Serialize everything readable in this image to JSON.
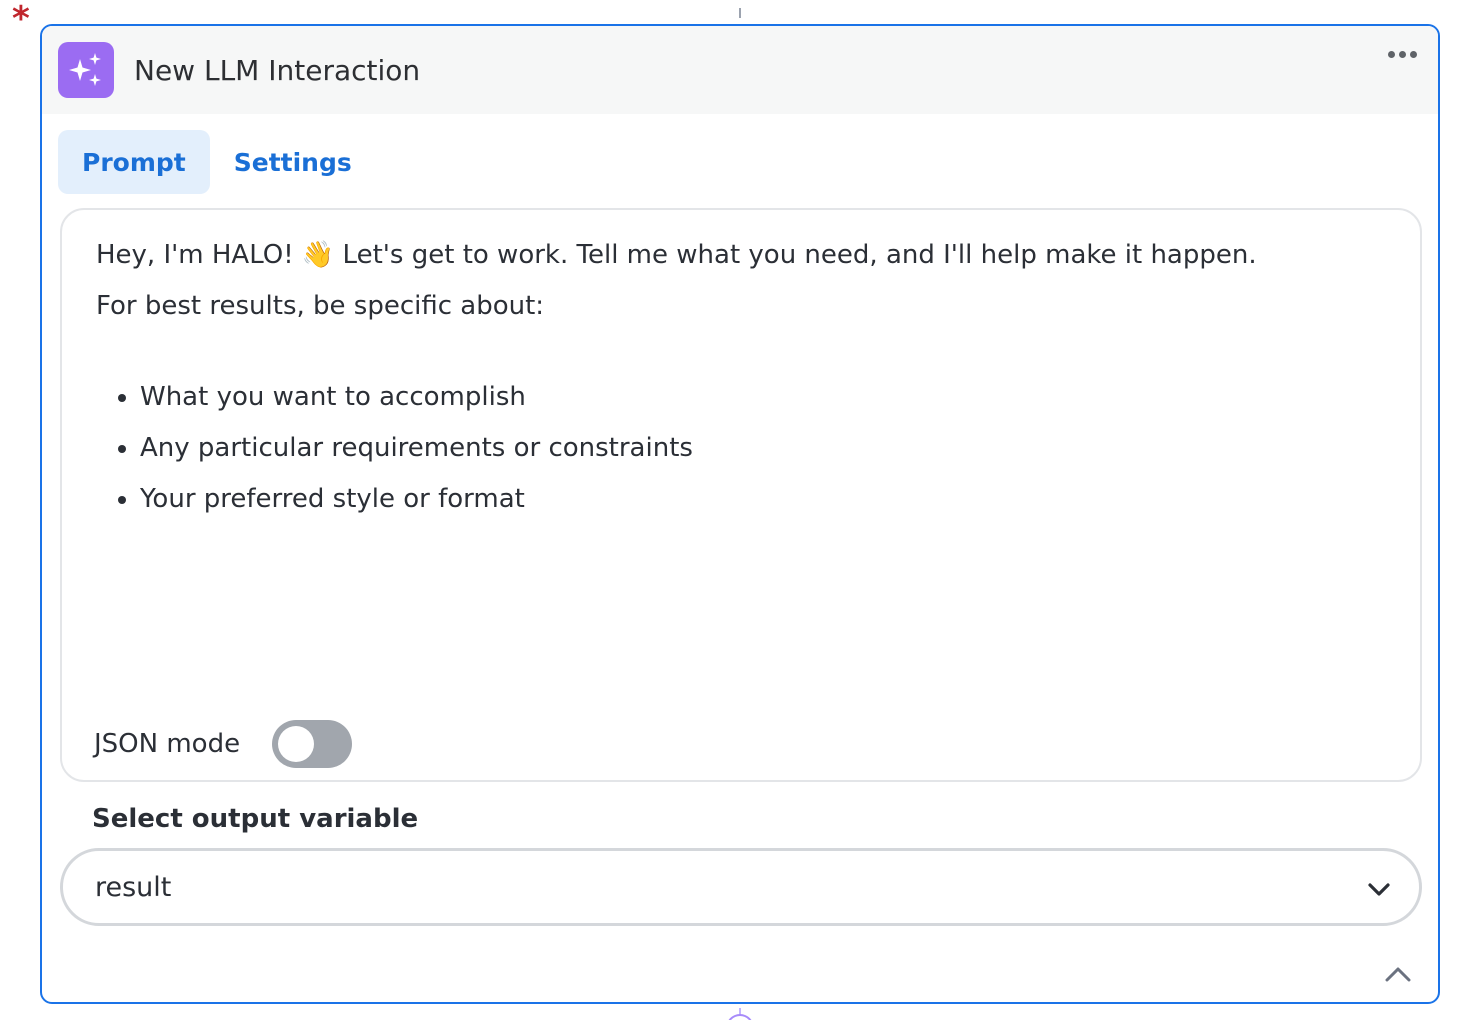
{
  "node": {
    "required_marker": "*",
    "title": "New LLM Interaction",
    "icon": "sparkles-icon",
    "accent_color": "#1a73e8",
    "icon_color": "#9b6cf2"
  },
  "tabs": [
    {
      "label": "Prompt",
      "active": true
    },
    {
      "label": "Settings",
      "active": false
    }
  ],
  "prompt": {
    "line1": "Hey, I'm HALO! 👋 Let's get to work. Tell me what you need, and I'll help make it happen.",
    "line2": "For best results, be specific about:",
    "bullets": [
      "What you want to accomplish",
      "Any particular requirements or constraints",
      "Your preferred style or format"
    ]
  },
  "json_mode": {
    "label": "JSON mode",
    "enabled": false
  },
  "output": {
    "label": "Select output variable",
    "selected": "result"
  }
}
